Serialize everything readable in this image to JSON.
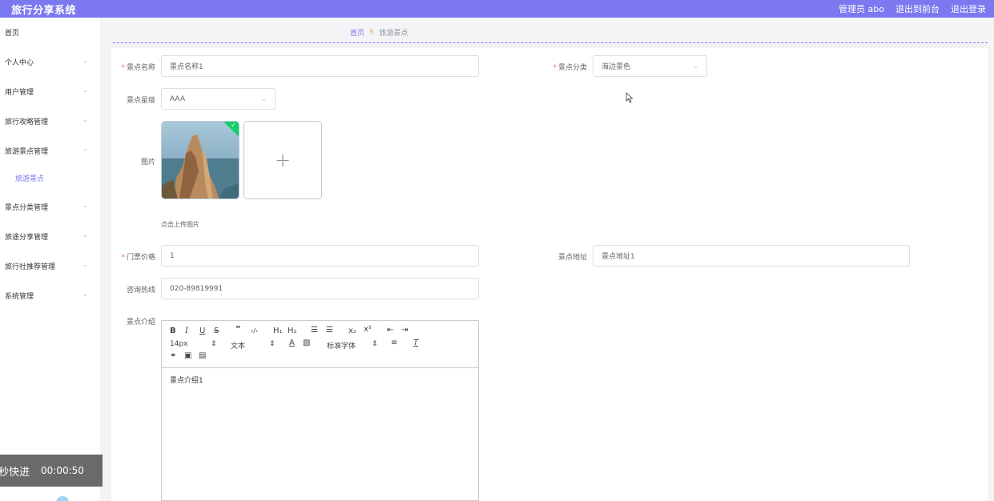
{
  "header": {
    "title": "旅行分享系统",
    "user": "管理员 abo",
    "back_front": "退出到前台",
    "logout": "退出登录"
  },
  "sidebar": {
    "items": [
      {
        "label": "首页"
      },
      {
        "label": "个人中心"
      },
      {
        "label": "用户管理"
      },
      {
        "label": "旅行攻略管理"
      },
      {
        "label": "旅游景点管理"
      },
      {
        "label": "景点分类管理"
      },
      {
        "label": "旅途分享管理"
      },
      {
        "label": "旅行社推荐管理"
      },
      {
        "label": "系统管理"
      }
    ],
    "active_sub": "旅游景点"
  },
  "breadcrumb": {
    "home": "首页",
    "current": "旅游景点"
  },
  "form": {
    "name_label": "景点名称",
    "name_value": "景点名称1",
    "category_label": "景点分类",
    "category_value": "海边景色",
    "level_label": "景点星级",
    "level_value": "AAA",
    "image_label": "图片",
    "upload_hint": "点击上传图片",
    "price_label": "门票价格",
    "price_value": "1",
    "address_label": "景点地址",
    "address_value": "景点地址1",
    "hotline_label": "咨询热线",
    "hotline_value": "020-89819991",
    "intro_label": "景点介绍",
    "intro_value": "景点介绍1"
  },
  "editor": {
    "font_size": "14px",
    "text_style": "文本",
    "font_family": "标准字体"
  },
  "video": {
    "speed_text": "秒快进",
    "time": "00:00:50"
  },
  "colors": {
    "accent": "#7b78f0",
    "required": "#f56c6c",
    "success": "#13ce66"
  }
}
